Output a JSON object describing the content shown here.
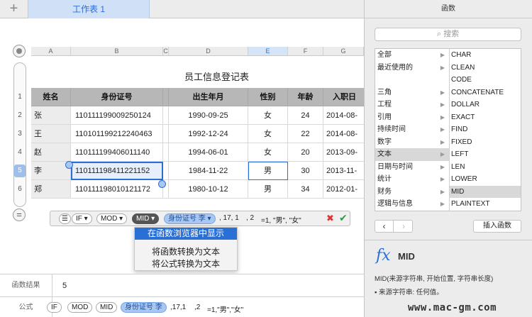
{
  "tabbar": {
    "sheet_name": "工作表 1"
  },
  "sheet": {
    "columns": [
      "A",
      "B",
      "C",
      "D",
      "E",
      "F",
      "G"
    ],
    "rows": [
      "1",
      "2",
      "3",
      "4",
      "5",
      "6"
    ],
    "selected_column": "E",
    "selected_row": "5",
    "title": "员工信息登记表",
    "headers": [
      "姓名",
      "身份证号",
      "出生年月",
      "性别",
      "年龄",
      "入职日"
    ],
    "records": [
      [
        "张",
        "110111199009250124",
        "1990-09-25",
        "女",
        "24",
        "2014-08-"
      ],
      [
        "王",
        "110101199212240463",
        "1992-12-24",
        "女",
        "22",
        "2014-08-"
      ],
      [
        "赵",
        "110111199406011140",
        "1994-06-01",
        "女",
        "20",
        "2013-09-"
      ],
      [
        "李",
        "110111198411221152",
        "1984-11-22",
        "男",
        "30",
        "2013-11-"
      ],
      [
        "郑",
        "110111198010121172",
        "1980-10-12",
        "男",
        "34",
        "2012-01-"
      ]
    ]
  },
  "formula_editor": {
    "tokens": [
      "IF ▾",
      "MOD ▾",
      "MID ▾",
      "身份证号 李 ▾"
    ],
    "args": [
      ", 17, 1",
      ", 2",
      "=1, \"男\", \"女\""
    ]
  },
  "context_menu": {
    "items": [
      "在函数浏览器中显示",
      "将函数转换为文本",
      "将公式转换为文本"
    ]
  },
  "result_bar": {
    "label": "函数结果",
    "value": "5"
  },
  "formula_bar": {
    "label": "公式",
    "tokens": [
      "IF",
      "MOD",
      "MID",
      "身份证号 李"
    ],
    "args": [
      ",17,1",
      ",2",
      "=1,\"男\",\"女\""
    ]
  },
  "panel": {
    "title": "函数",
    "search_placeholder": "搜索",
    "categories": [
      "全部",
      "最近使用的",
      "",
      "三角",
      "工程",
      "引用",
      "持续时间",
      "数字",
      "文本",
      "日期与时间",
      "统计",
      "财务",
      "逻辑与信息"
    ],
    "selected_category": "文本",
    "functions": [
      "CHAR",
      "CLEAN",
      "CODE",
      "CONCATENATE",
      "DOLLAR",
      "EXACT",
      "FIND",
      "FIXED",
      "LEFT",
      "LEN",
      "LOWER",
      "MID",
      "PLAINTEXT"
    ],
    "selected_function": "MID",
    "nav_prev": "‹",
    "nav_next": "›",
    "insert_label": "插入函数",
    "fx_symbol": "fx",
    "detail_name": "MID",
    "signature": "MID(来源字符串, 开始位置, 字符串长度)",
    "param_line": "▪ 来源字符串:  任何值。"
  },
  "watermark": "www.mac-gm.com",
  "colors": {
    "accent": "#2a6fd6",
    "selection": "#cfe0f7",
    "header_fill": "#b7b7b7"
  }
}
